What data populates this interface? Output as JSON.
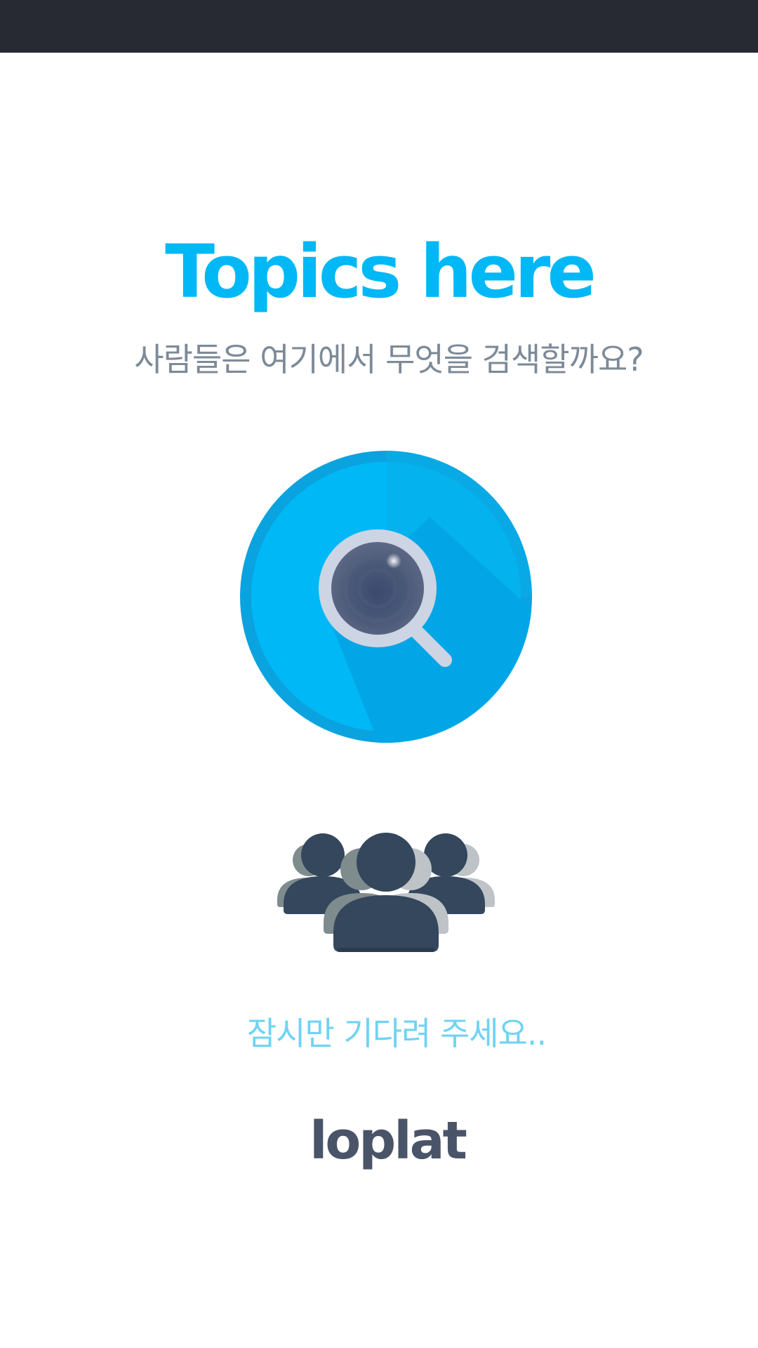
{
  "header": {
    "title": "Topics here",
    "subtitle": "사람들은 여기에서 무엇을 검색할까요?"
  },
  "illustrations": {
    "search_icon": "magnifying-glass-icon",
    "people_icon": "people-group-icon"
  },
  "loading": {
    "message": "잠시만 기다려 주세요.."
  },
  "brand": {
    "name": "loplat"
  },
  "colors": {
    "status_bar": "#282a33",
    "title": "#00b8f5",
    "subtitle": "#7d8a98",
    "loading_text": "#6fd3f3",
    "brand": "#4a5469",
    "circle": "#00b8f5",
    "circle_rim": "#0aa3df",
    "people_dark": "#34475c",
    "people_mid": "#7f8c8d",
    "people_light": "#bdc3c7"
  }
}
